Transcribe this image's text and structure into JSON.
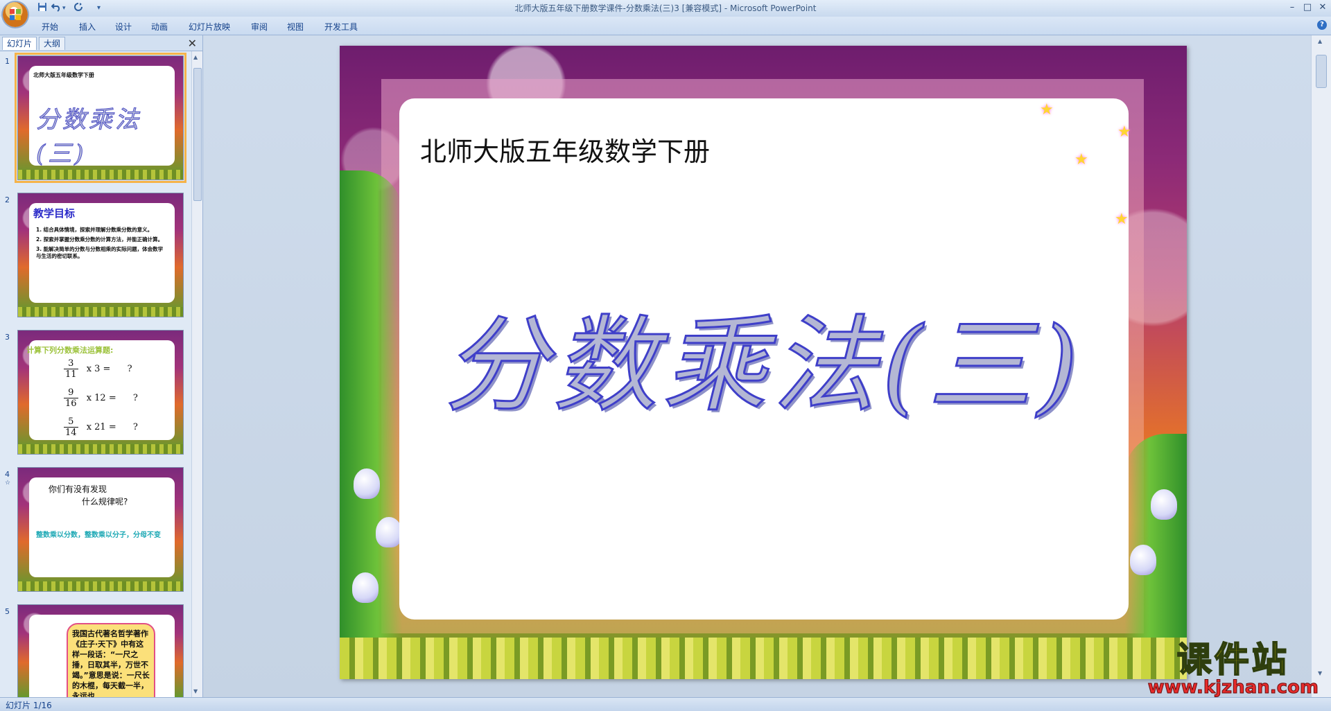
{
  "window": {
    "title": "北师大版五年级下册数学课件-分数乘法(三)3 [兼容模式] - Microsoft PowerPoint",
    "minimize": "–",
    "maximize": "□",
    "close": "✕"
  },
  "quick_access": {
    "save_icon": "save-icon",
    "undo_icon": "undo-icon",
    "redo_icon": "redo-icon",
    "customize": "▾"
  },
  "ribbon": {
    "tabs": [
      "开始",
      "插入",
      "设计",
      "动画",
      "幻灯片放映",
      "审阅",
      "视图",
      "开发工具"
    ],
    "help": "?"
  },
  "left_pane": {
    "tabs": [
      "幻灯片",
      "大纲"
    ],
    "close": "✕"
  },
  "thumbnails": [
    {
      "number": "1",
      "subtitle": "北师大版五年级数学下册",
      "title": "分数乘法(三)"
    },
    {
      "number": "2",
      "heading": "教学目标",
      "items": [
        "1. 结合具体情境，探索并理解分数乘分数的意义。",
        "2. 探索并掌握分数乘分数的计算方法，并能正确计算。",
        "3. 能解决简单的分数与分数相乘的实际问题，体会数学与生活的密切联系。"
      ]
    },
    {
      "number": "3",
      "heading": "计算下列分数乘法运算题:",
      "rows": [
        {
          "num": "3",
          "den": "11",
          "mult": "x 3 =",
          "result": "?"
        },
        {
          "num": "9",
          "den": "16",
          "mult": "x 12 =",
          "result": "?"
        },
        {
          "num": "5",
          "den": "14",
          "mult": "x 21 =",
          "result": "?"
        }
      ]
    },
    {
      "number": "4",
      "marker": "☆",
      "line1": "你们有没有发现",
      "line2": "什么规律呢?",
      "note": "整数乘以分数，整数乘以分子，分母不变"
    },
    {
      "number": "5",
      "text": "我国古代著名哲学著作《庄子·天下》中有这样一段话：“一尺之捶，日取其半，万世不竭。”意思是说：一尺长的木棍，每天截一半，永远也"
    }
  ],
  "slide": {
    "subtitle": "北师大版五年级数学下册",
    "title": "分数乘法(三)"
  },
  "watermark": {
    "name": "课件站",
    "url": "www.kjzhan.com"
  },
  "status": {
    "slide_indicator": "幻灯片 1/16"
  },
  "colors": {
    "ribbon_text": "#15428b",
    "title_outline": "#3f3fc9",
    "title_fill": "#b4b7d4",
    "selection": "#f5b34a"
  }
}
